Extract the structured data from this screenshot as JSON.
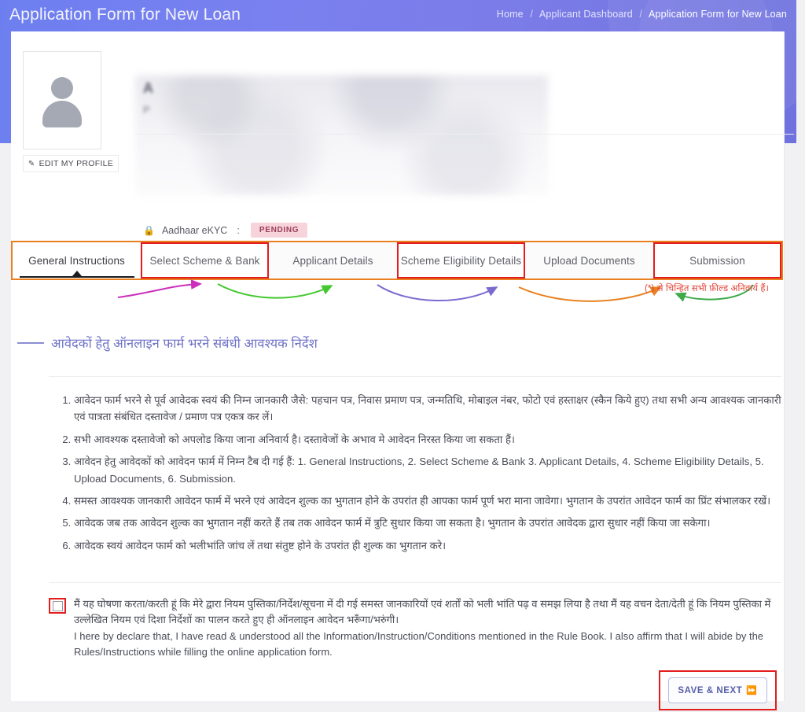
{
  "header": {
    "title": "Application Form for New Loan",
    "breadcrumb": [
      "Home",
      "Applicant Dashboard",
      "Application Form for New Loan"
    ],
    "separator": "/",
    "accent_color": "#7a80ef"
  },
  "profile": {
    "avatar_icon": "user-avatar-icon",
    "edit_label": "EDIT MY PROFILE",
    "edit_icon": "pencil-edit-icon",
    "lock_icon": "lock-icon",
    "ekyc_label": "Aadhaar eKYC",
    "ekyc_colon": ":",
    "ekyc_status": "PENDING",
    "ekyc_status_color": "#9c3d55",
    "ekyc_badge_bg": "#f7d4dc",
    "redacted_line1": "A",
    "redacted_line2": "P"
  },
  "tabs": [
    {
      "label": "General Instructions",
      "active": true,
      "highlighted": false
    },
    {
      "label": "Select Scheme & Bank",
      "active": false,
      "highlighted": true
    },
    {
      "label": "Applicant Details",
      "active": false,
      "highlighted": false
    },
    {
      "label": "Scheme Eligibility Details",
      "active": false,
      "highlighted": true
    },
    {
      "label": "Upload Documents",
      "active": false,
      "highlighted": false
    },
    {
      "label": "Submission",
      "active": false,
      "highlighted": true
    }
  ],
  "annotation": {
    "note": "(*) से चिन्हित सभी फ़ील्ड अनिवार्य हैं।",
    "note_color": "#e2453a",
    "outline_color": "#e8801f",
    "highlight_color": "#e31c1c",
    "arrow_colors": [
      "#cc2fbb",
      "#44c830",
      "#7a6ad0",
      "#e8801f",
      "#3faa4a"
    ]
  },
  "section": {
    "heading": "आवेदकों हेतु ऑनलाइन फार्म भरने संबंधी आवश्यक निर्देश",
    "heading_color": "#6f72c8"
  },
  "instructions": [
    "आवेदन फार्म भरने से पूर्व आवेदक स्वयं की निम्न जानकारी जैसे: पहचान पत्र, निवास प्रमाण पत्र, जन्मतिथि, मोबाइल नंबर, फोटो एवं हस्ताक्षर (स्कैन किये हुए) तथा सभी अन्य आवश्यक जानकारी एवं पात्रता संबंधित दस्तावेज / प्रमाण पत्र एकत्र कर लें।",
    "सभी आवश्यक दस्तावेजो को अपलोड किया जाना अनिवार्य है। दस्तावेजों के अभाव मे आवेदन निरस्त किया जा सकता हैं।",
    "आवेदन हेतु आवेदकों को आवेदन फार्म में निम्न टैब दी गई हैं: 1. General Instructions, 2. Select Scheme & Bank 3. Applicant Details, 4. Scheme Eligibility Details, 5. Upload Documents, 6. Submission.",
    "समस्त आवश्यक जानकारी आवेदन फार्म में भरने एवं आवेदन शुल्क का भुगतान होने के उपरांत ही आपका फार्म पूर्ण भरा माना जावेगा। भुगतान के उपरांत आवेदन फार्म का प्रिंट संभालकर रखें।",
    "आवेदक जब तक आवेदन शुल्क का भुगतान नहीं करते हैं तब तक आवेदन फार्म में त्रुटि सुधार किया जा सकता है। भुगतान के उपरांत आवेदक द्वारा सुधार नहीं किया जा सकेगा।",
    "आवेदक स्वयं आवेदन फार्म को भलीभांति जांच लें तथा संतुष्ट होने के उपरांत ही शुल्क का भुगतान करे।"
  ],
  "declaration": {
    "checked": false,
    "hindi": "मैं यह घोषणा करता/करती हूं कि मेरे द्वारा नियम पुस्तिका/निर्देश/सूचना में दी गई समस्त जानकारियों एवं शर्तों को भली भांति पढ़ व समझ लिया है तथा मैं यह वचन देता/देती हूं कि नियम पुस्तिका में उल्लेखित नियम एवं दिशा निर्देशों का पालन करते हुए ही ऑनलाइन आवेदन भरूँगा/भरुंगी।",
    "english": "I here by declare that, I have read & understood all the Information/Instruction/Conditions mentioned in the Rule Book. I also affirm that I will abide by the Rules/Instructions while filling the online application form."
  },
  "footer": {
    "save_label": "SAVE & NEXT",
    "save_icon": "fast-forward-icon",
    "save_icon_glyph": "⏩"
  }
}
